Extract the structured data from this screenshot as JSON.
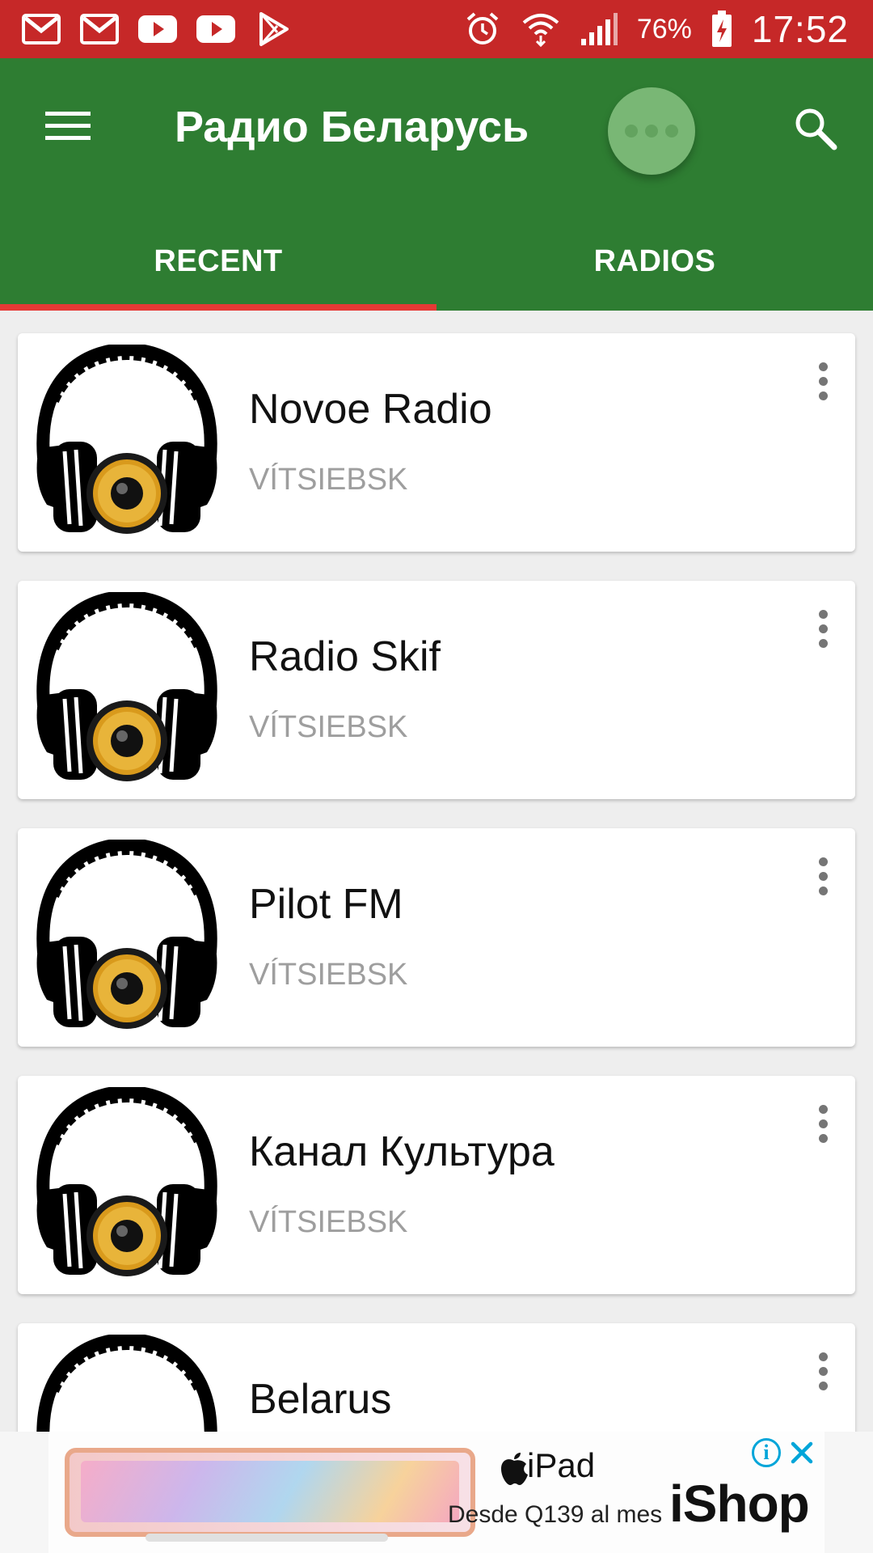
{
  "status_bar": {
    "notification_icons": [
      "gmail-icon",
      "gmail-icon",
      "youtube-icon",
      "youtube-icon",
      "play-store-icon"
    ],
    "system_icons": [
      "alarm-icon",
      "wifi-icon",
      "signal-icon",
      "battery-charging-icon"
    ],
    "battery": "76%",
    "time": "17:52",
    "background": "#c62828"
  },
  "app_bar": {
    "title": "Радио Беларусь",
    "menu_icon": "hamburger-menu-icon",
    "search_icon": "search-icon",
    "more_icon": "more-bubble-icon",
    "background": "#2e7d32"
  },
  "tabs": [
    {
      "label": "RECENT",
      "active": true
    },
    {
      "label": "RADIOS",
      "active": false
    }
  ],
  "stations": [
    {
      "name": "Novoe Radio",
      "city": "VÍTSIEBSK",
      "icon": "headphones-icon"
    },
    {
      "name": "Radio Skif",
      "city": "VÍTSIEBSK",
      "icon": "headphones-icon"
    },
    {
      "name": "Pilot FM",
      "city": "VÍTSIEBSK",
      "icon": "headphones-icon"
    },
    {
      "name": "Канал Культура",
      "city": "VÍTSIEBSK",
      "icon": "headphones-icon"
    },
    {
      "name": "Belarus",
      "city": "",
      "icon": "headphones-icon"
    }
  ],
  "ad": {
    "product": "iPad",
    "price": "Desde Q139 al mes",
    "brand": "iShop"
  },
  "colors": {
    "accent_indicator": "#e53935",
    "secondary_text": "#9e9e9e"
  }
}
